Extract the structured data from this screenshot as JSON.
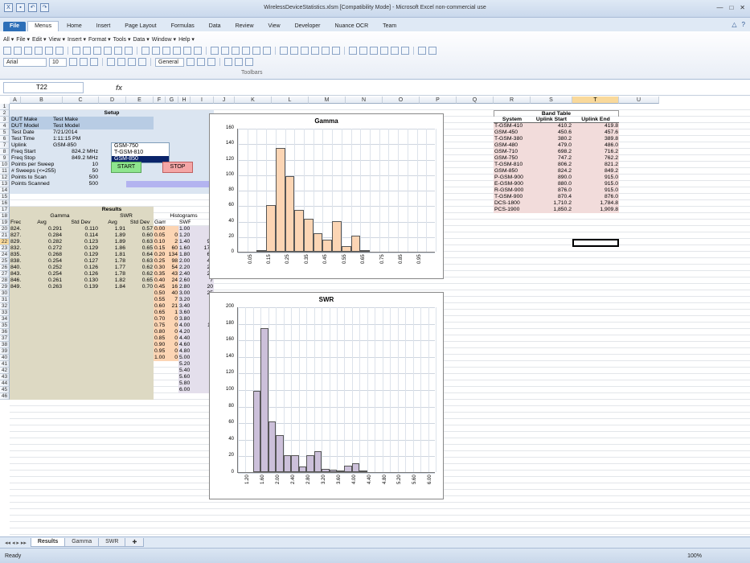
{
  "window": {
    "title": "WirelessDeviceStatistics.xlsm  [Compatibility Mode]  -  Microsoft Excel non-commercial use"
  },
  "ribbon": {
    "tabs": [
      "File",
      "Menus",
      "Home",
      "Insert",
      "Page Layout",
      "Formulas",
      "Data",
      "Review",
      "View",
      "Developer",
      "Nuance OCR",
      "Team"
    ],
    "menu_row": [
      "All",
      "File",
      "Edit",
      "View",
      "Insert",
      "Format",
      "Tools",
      "Data",
      "Window",
      "Help"
    ],
    "font_name": "Arial",
    "font_size": "10",
    "number_format": "General",
    "toolbar_label": "Toolbars"
  },
  "formula_bar": {
    "name_box": "T22",
    "fx": "fx",
    "value": ""
  },
  "columns": [
    "A",
    "B",
    "C",
    "D",
    "E",
    "F",
    "G",
    "H",
    "I",
    "J",
    "K",
    "L",
    "M",
    "N",
    "O",
    "P",
    "Q",
    "R",
    "S",
    "T",
    "U"
  ],
  "setup": {
    "title": "Setup",
    "rows": [
      {
        "label": "DUT Make",
        "value": "Test Make"
      },
      {
        "label": "DUT Model",
        "value": "Test Model"
      },
      {
        "label": "Test Date",
        "value": "7/21/2014"
      },
      {
        "label": "Test Time",
        "value": "1:11:15 PM"
      },
      {
        "label": "Uplink",
        "value": "GSM-850"
      },
      {
        "label": "Freq Start",
        "value": "824.2 MHz"
      },
      {
        "label": "Freq Stop",
        "value": "849.2 MHz"
      },
      {
        "label": "Points per Sweep",
        "value": "10"
      },
      {
        "label": "# Sweeps (<=255)",
        "value": "50"
      },
      {
        "label": "Points to Scan",
        "value": "500"
      },
      {
        "label": "Points Scanned",
        "value": "500"
      }
    ],
    "list_items": [
      "GSM-750",
      "T-GSM-810",
      "GSM-850"
    ],
    "start_label": "START",
    "stop_label": "STOP"
  },
  "results": {
    "title": "Results",
    "group_headers": {
      "gamma": "Gamma",
      "swr": "SWR",
      "histograms": "Histograms"
    },
    "col_headers": [
      "Freq",
      "Avg",
      "Std Dev",
      "Avg",
      "Std Dev",
      "Gamma",
      "",
      "SWR",
      ""
    ],
    "rows": [
      [
        "824.2",
        "0.291",
        "0.110",
        "1.91",
        "0.57"
      ],
      [
        "827.0",
        "0.284",
        "0.114",
        "1.89",
        "0.60"
      ],
      [
        "829.8",
        "0.282",
        "0.123",
        "1.89",
        "0.63"
      ],
      [
        "832.5",
        "0.272",
        "0.129",
        "1.86",
        "0.65"
      ],
      [
        "835.3",
        "0.268",
        "0.129",
        "1.81",
        "0.64"
      ],
      [
        "838.1",
        "0.254",
        "0.127",
        "1.78",
        "0.63"
      ],
      [
        "840.9",
        "0.252",
        "0.126",
        "1.77",
        "0.62"
      ],
      [
        "843.6",
        "0.254",
        "0.126",
        "1.78",
        "0.62"
      ],
      [
        "846.4",
        "0.261",
        "0.130",
        "1.82",
        "0.65"
      ],
      [
        "849.2",
        "0.263",
        "0.139",
        "1.84",
        "0.70"
      ]
    ],
    "gamma_hist": [
      [
        "0.00",
        ""
      ],
      [
        "0.05",
        "0"
      ],
      [
        "0.10",
        "2"
      ],
      [
        "0.15",
        "60"
      ],
      [
        "0.20",
        "134"
      ],
      [
        "0.25",
        "98"
      ],
      [
        "0.30",
        "54"
      ],
      [
        "0.35",
        "43"
      ],
      [
        "0.40",
        "24"
      ],
      [
        "0.45",
        "16"
      ],
      [
        "0.50",
        "40"
      ],
      [
        "0.55",
        "7"
      ],
      [
        "0.60",
        "21"
      ],
      [
        "0.65",
        "1"
      ],
      [
        "0.70",
        "0"
      ],
      [
        "0.75",
        "0"
      ],
      [
        "0.80",
        "0"
      ],
      [
        "0.85",
        "0"
      ],
      [
        "0.90",
        "0"
      ],
      [
        "0.95",
        "0"
      ],
      [
        "1.00",
        "0"
      ]
    ],
    "swr_hist": [
      [
        "1.00",
        ""
      ],
      [
        "1.20",
        "0"
      ],
      [
        "1.40",
        "98"
      ],
      [
        "1.60",
        "174"
      ],
      [
        "1.80",
        "61"
      ],
      [
        "2.00",
        "45"
      ],
      [
        "2.20",
        "20"
      ],
      [
        "2.40",
        "20"
      ],
      [
        "2.60",
        "7"
      ],
      [
        "2.80",
        "20"
      ],
      [
        "3.00",
        "25"
      ],
      [
        "3.20",
        "4"
      ],
      [
        "3.40",
        "3"
      ],
      [
        "3.60",
        "2"
      ],
      [
        "3.80",
        "8"
      ],
      [
        "4.00",
        "11"
      ],
      [
        "4.20",
        "1"
      ],
      [
        "4.40",
        "0"
      ],
      [
        "4.60",
        "0"
      ],
      [
        "4.80",
        "0"
      ],
      [
        "5.00",
        "0"
      ],
      [
        "5.20",
        "0"
      ],
      [
        "5.40",
        "0"
      ],
      [
        "5.60",
        "0"
      ],
      [
        "5.80",
        "0"
      ],
      [
        "6.00",
        "0"
      ]
    ]
  },
  "band_table": {
    "title": "Band Table",
    "headers": [
      "System",
      "Uplink Start",
      "Uplink End"
    ],
    "rows": [
      [
        "T-GSM-410",
        "410.2",
        "419.8"
      ],
      [
        "GSM-450",
        "450.6",
        "457.6"
      ],
      [
        "T-GSM-380",
        "380.2",
        "389.8"
      ],
      [
        "GSM-480",
        "479.0",
        "486.0"
      ],
      [
        "GSM-710",
        "698.2",
        "716.2"
      ],
      [
        "GSM-750",
        "747.2",
        "762.2"
      ],
      [
        "T-GSM-810",
        "806.2",
        "821.2"
      ],
      [
        "GSM-850",
        "824.2",
        "849.2"
      ],
      [
        "P-GSM-900",
        "890.0",
        "915.0"
      ],
      [
        "E-GSM-900",
        "880.0",
        "915.0"
      ],
      [
        "R-GSM-900",
        "876.0",
        "915.0"
      ],
      [
        "T-GSM-900",
        "870.4",
        "876.0"
      ],
      [
        "DCS-1800",
        "1,710.2",
        "1,784.8"
      ],
      [
        "PCS-1900",
        "1,850.2",
        "1,909.8"
      ]
    ]
  },
  "chart_data": [
    {
      "type": "bar",
      "title": "Gamma",
      "categories": [
        "0.00",
        "0.05",
        "0.10",
        "0.15",
        "0.20",
        "0.25",
        "0.30",
        "0.35",
        "0.40",
        "0.45",
        "0.50",
        "0.55",
        "0.60",
        "0.65",
        "0.70",
        "0.75",
        "0.80",
        "0.85",
        "0.90",
        "0.95",
        "1.00"
      ],
      "tick_labels": [
        "0.05",
        "0.15",
        "0.25",
        "0.35",
        "0.45",
        "0.55",
        "0.65",
        "0.75",
        "0.85",
        "0.95"
      ],
      "values": [
        0,
        0,
        2,
        60,
        134,
        98,
        54,
        43,
        24,
        16,
        40,
        7,
        21,
        1,
        0,
        0,
        0,
        0,
        0,
        0,
        0
      ],
      "ylim": [
        0,
        160
      ],
      "yticks": [
        0,
        20,
        40,
        60,
        80,
        100,
        120,
        140,
        160
      ],
      "color": "#fcd5b4",
      "grid": true
    },
    {
      "type": "bar",
      "title": "SWR",
      "categories": [
        "1.00",
        "1.20",
        "1.40",
        "1.60",
        "1.80",
        "2.00",
        "2.20",
        "2.40",
        "2.60",
        "2.80",
        "3.00",
        "3.20",
        "3.40",
        "3.60",
        "3.80",
        "4.00",
        "4.20",
        "4.40",
        "4.60",
        "4.80",
        "5.00",
        "5.20",
        "5.40",
        "5.60",
        "5.80",
        "6.00"
      ],
      "tick_labels": [
        "1.20",
        "1.60",
        "2.00",
        "2.40",
        "2.80",
        "3.20",
        "3.60",
        "4.00",
        "4.40",
        "4.80",
        "5.20",
        "5.60",
        "6.00"
      ],
      "values": [
        0,
        0,
        98,
        174,
        61,
        45,
        20,
        20,
        7,
        20,
        25,
        4,
        3,
        2,
        8,
        11,
        1,
        0,
        0,
        0,
        0,
        0,
        0,
        0,
        0,
        0
      ],
      "ylim": [
        0,
        200
      ],
      "yticks": [
        0,
        20,
        40,
        60,
        80,
        100,
        120,
        140,
        160,
        180,
        200
      ],
      "color": "#ccc0da",
      "grid": true
    }
  ],
  "sheet_tabs": [
    "Results",
    "Gamma",
    "SWR"
  ],
  "status": {
    "ready": "Ready",
    "zoom": "100%"
  },
  "colors": {
    "setup_bg": "#dbe5f1",
    "results_bg": "#ddd9c3",
    "gamma_hist_bg": "#fcd5b4",
    "swr_hist_bg": "#e4dfec",
    "band_bg": "#f2dcdb",
    "selected": "#f9d99b"
  }
}
